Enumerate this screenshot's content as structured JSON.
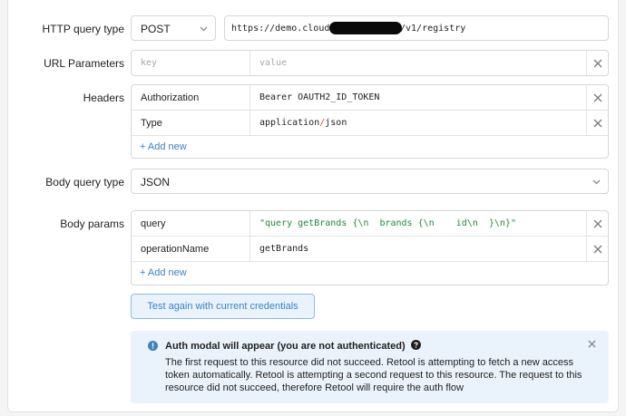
{
  "http_query_type": {
    "label": "HTTP query type",
    "method": "POST",
    "url_prefix": "https://demo.cloud",
    "url_suffix": "/v1/registry"
  },
  "url_parameters": {
    "label": "URL Parameters",
    "key_placeholder": "key",
    "value_placeholder": "value"
  },
  "headers": {
    "label": "Headers",
    "rows": [
      {
        "key": "Authorization",
        "value": "Bearer OAUTH2_ID_TOKEN"
      },
      {
        "key": "Type",
        "value_a": "application",
        "value_sep": "/",
        "value_b": "json"
      }
    ],
    "add_new": "+ Add new"
  },
  "body_query_type": {
    "label": "Body query type",
    "value": "JSON"
  },
  "body_params": {
    "label": "Body params",
    "rows": [
      {
        "key": "query",
        "value": "\"query getBrands {\\n  brands {\\n    id\\n  }\\n}\""
      },
      {
        "key": "operationName",
        "value": "getBrands"
      }
    ],
    "add_new": "+ Add new"
  },
  "test_button": {
    "label": "Test again with current credentials"
  },
  "alert": {
    "title": "Auth modal will appear (you are not authenticated)",
    "body": "The first request to this resource did not succeed. Retool is attempting to fetch a new access token automatically. Retool is attempting a second request to this resource. The request to this resource did not succeed, therefore Retool will require the auth flow",
    "accent_color": "#3c82c4",
    "background": "#eaf3fc"
  }
}
